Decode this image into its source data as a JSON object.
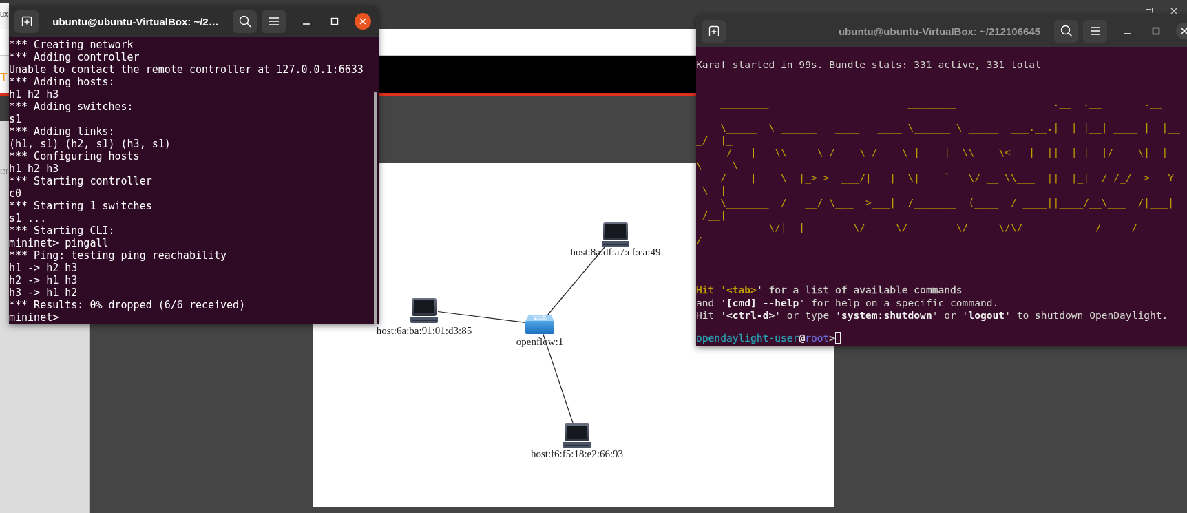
{
  "browser": {
    "tab_label": "ux",
    "accent_label": "T",
    "side_label": "er"
  },
  "topology": {
    "nodes": [
      {
        "kind": "host",
        "label": "host:8a:df:a7:cf:ea:49",
        "connected": true
      },
      {
        "kind": "host",
        "label": "host:6a:ba:91:01:d3:85",
        "connected": true
      },
      {
        "kind": "switch",
        "label": "openflow:1"
      },
      {
        "kind": "host",
        "label": "host:f6:f5:18:e2:66:93",
        "connected": true
      }
    ]
  },
  "terminals": [
    {
      "title": "ubuntu@ubuntu-VirtualBox: ~/2…",
      "active": true,
      "lines": [
        "*** Creating network",
        "*** Adding controller",
        "Unable to contact the remote controller at 127.0.0.1:6633",
        "*** Adding hosts:",
        "h1 h2 h3",
        "*** Adding switches:",
        "s1",
        "*** Adding links:",
        "(h1, s1) (h2, s1) (h3, s1)",
        "*** Configuring hosts",
        "h1 h2 h3",
        "*** Starting controller",
        "c0",
        "*** Starting 1 switches",
        "s1 ...",
        "*** Starting CLI:",
        "mininet> pingall",
        "*** Ping: testing ping reachability",
        "h1 -> h2 h3",
        "h2 -> h1 h3",
        "h3 -> h1 h2",
        "*** Results: 0% dropped (6/6 received)",
        "mininet>"
      ]
    },
    {
      "title": "ubuntu@ubuntu-VirtualBox: ~/212106645",
      "active": false,
      "lines": [
        "Karaf started in 99s. Bundle stats: 331 active, 331 total",
        {
          "kind": "blank"
        },
        {
          "kind": "blank"
        },
        {
          "kind": "banner",
          "text": "    ________                       ________                .__  .__       .__"
        },
        {
          "kind": "banner",
          "text": "  __"
        },
        {
          "kind": "banner",
          "text": "    \\_____  \\ ______   ____   ____ \\______ \\ _____  ___.__.|  | |__| ____ |  |__"
        },
        {
          "kind": "banner",
          "text": "_/  |_"
        },
        {
          "kind": "banner",
          "text": "     /   |   \\\\____ \\_/ __ \\ /    \\ |    |  \\\\__  \\<   |  ||  | |  |/ ___\\|  |"
        },
        {
          "kind": "banner",
          "text": "\\   __\\"
        },
        {
          "kind": "banner",
          "text": "    /    |    \\  |_> >  ___/|   |  \\|    `   \\/ __ \\\\___  ||  |_|  / /_/  >   Y"
        },
        {
          "kind": "banner",
          "text": " \\  |"
        },
        {
          "kind": "banner",
          "text": "    \\_______  /   __/ \\___  >___|  /_______  (____  / ____||____/__\\___  /|___|"
        },
        {
          "kind": "banner",
          "text": " /__|"
        },
        {
          "kind": "banner",
          "text": "            \\/|__|        \\/     \\/        \\/     \\/\\/            /_____/"
        },
        {
          "kind": "banner",
          "text": "/"
        },
        {
          "kind": "blank"
        },
        {
          "kind": "blank"
        },
        {
          "kind": "blank"
        },
        {
          "kind": "mixed",
          "segments": [
            {
              "text": "Hit '",
              "color": "#c4a000",
              "bold": false
            },
            {
              "text": "<tab>",
              "color": "#c4a000",
              "bold": true
            },
            {
              "text": "' for a list of available commands",
              "color": "#d3d7cf",
              "bold": false
            }
          ]
        },
        {
          "kind": "rich",
          "text": "and '**[cmd] --help**' for help on a specific command."
        },
        {
          "kind": "rich",
          "text": "Hit '**<ctrl-d>**' or type '**system:shutdown**' or '**logout**' to shutdown OpenDaylight."
        },
        {
          "kind": "blank"
        },
        {
          "kind": "prompt",
          "segments": [
            {
              "text": "opendaylight-user",
              "color": "#2aa1b3",
              "bold": false
            },
            {
              "text": "@",
              "color": "#eeeeec",
              "bold": false
            },
            {
              "text": "root",
              "color": "#6b6bd6",
              "bold": false
            },
            {
              "text": ">",
              "color": "#d3d7cf",
              "bold": false
            }
          ]
        }
      ]
    }
  ]
}
